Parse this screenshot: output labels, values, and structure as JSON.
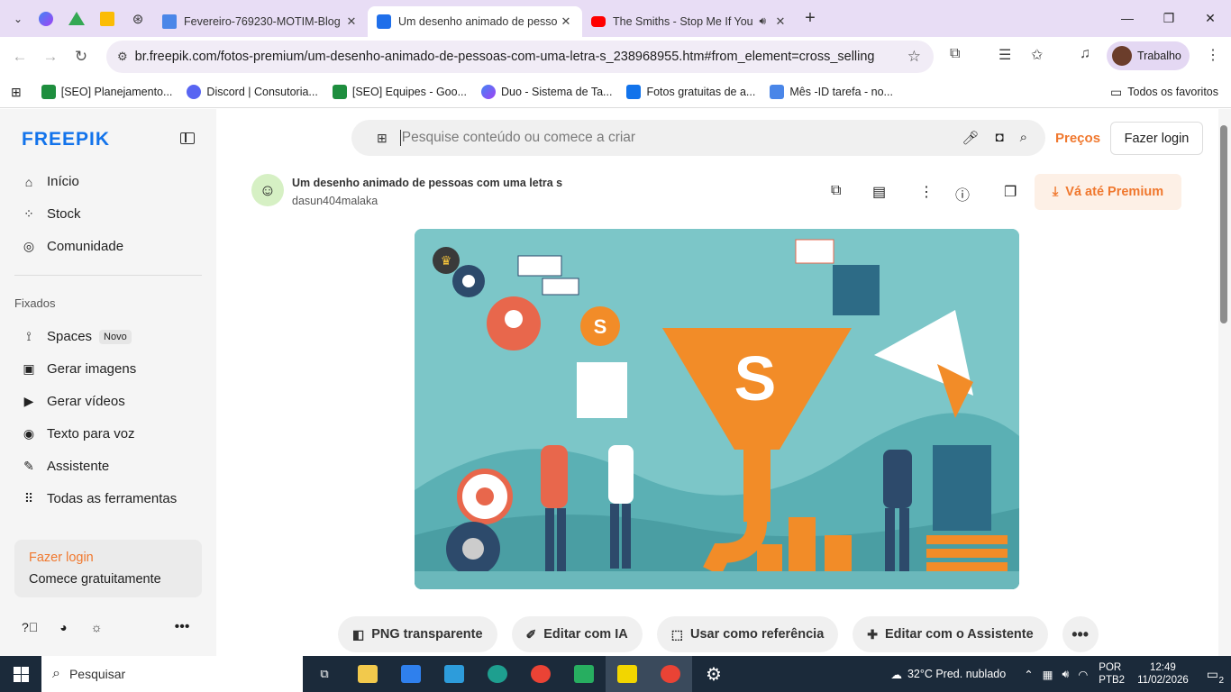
{
  "browser": {
    "tabs": [
      {
        "title": "Fevereiro-769230-MOTIM-Blog",
        "color": "#4a86e8",
        "active": false
      },
      {
        "title": "Um desenho animado de pesso",
        "color": "#1f6fea",
        "active": true
      },
      {
        "title": "The Smiths - Stop Me If You",
        "color": "#ff0000",
        "active": false
      }
    ],
    "url": "br.freepik.com/fotos-premium/um-desenho-animado-de-pessoas-com-uma-letra-s_238968955.htm#from_element=cross_selling__p...",
    "profile_label": "Trabalho",
    "bookmarks": [
      {
        "label": "[SEO] Planejamento...",
        "color": "#1e8e3e"
      },
      {
        "label": "Discord | Consutoria...",
        "color": "#5865f2"
      },
      {
        "label": "[SEO] Equipes - Goo...",
        "color": "#1e8e3e"
      },
      {
        "label": "Duo - Sistema de Ta...",
        "color": "#8a5cf6"
      },
      {
        "label": "Fotos gratuitas de a...",
        "color": "#1273eb"
      },
      {
        "label": "Mês -ID tarefa - no...",
        "color": "#4a86e8"
      }
    ],
    "all_favorites": "Todos os favoritos"
  },
  "sidebar": {
    "logo": "FREEPIK",
    "nav": [
      {
        "label": "Início",
        "icon": "⌂"
      },
      {
        "label": "Stock",
        "icon": "⁘"
      },
      {
        "label": "Comunidade",
        "icon": "◎"
      }
    ],
    "fixed_label": "Fixados",
    "fixed": [
      {
        "label": "Spaces",
        "icon": "ꝸ",
        "badge": "Novo"
      },
      {
        "label": "Gerar imagens",
        "icon": "▣"
      },
      {
        "label": "Gerar vídeos",
        "icon": "▶"
      },
      {
        "label": "Texto para voz",
        "icon": "◉"
      },
      {
        "label": "Assistente",
        "icon": "✎"
      },
      {
        "label": "Todas as ferramentas",
        "icon": "⠿"
      }
    ],
    "login_card": {
      "login": "Fazer login",
      "start": "Comece gratuitamente"
    }
  },
  "header": {
    "search_placeholder": "Pesquise conteúdo ou comece a criar",
    "pricing": "Preços",
    "login": "Fazer login"
  },
  "image": {
    "title": "Um desenho animado de pessoas com uma letra s",
    "author": "dasun404malaka",
    "premium_button": "Vá até Premium"
  },
  "actions": [
    {
      "label": "PNG transparente",
      "icon": "◧"
    },
    {
      "label": "Editar com IA",
      "icon": "✐"
    },
    {
      "label": "Usar como referência",
      "icon": "⬚"
    },
    {
      "label": "Editar com o Assistente",
      "icon": "✚"
    }
  ],
  "taskbar": {
    "search": "Pesquisar",
    "weather": "32°C  Pred. nublado",
    "lang1": "POR",
    "lang2": "PTB2",
    "time": "12:49",
    "date": "11/02/2026",
    "notifications": "2"
  }
}
